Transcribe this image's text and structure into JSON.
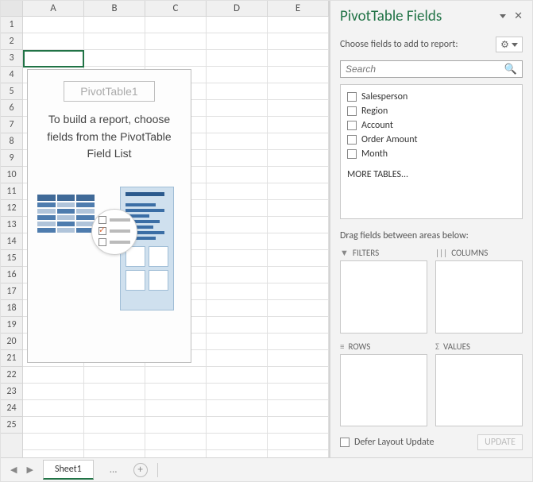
{
  "columns": [
    "A",
    "B",
    "C",
    "D",
    "E"
  ],
  "rows": [
    "1",
    "2",
    "3",
    "4",
    "5",
    "6",
    "7",
    "8",
    "9",
    "10",
    "11",
    "12",
    "13",
    "14",
    "15",
    "16",
    "17",
    "18",
    "19",
    "20",
    "21",
    "22",
    "23",
    "24",
    "25"
  ],
  "pivot": {
    "title": "PivotTable1",
    "message": "To build a report, choose fields from the PivotTable Field List"
  },
  "sidebar": {
    "title": "PivotTable Fields",
    "choose_label": "Choose fields to add to report:",
    "search_placeholder": "Search",
    "fields": [
      "Salesperson",
      "Region",
      "Account",
      "Order Amount",
      "Month"
    ],
    "more_label": "MORE TABLES...",
    "drag_label": "Drag fields between areas below:",
    "areas": {
      "filters": "FILTERS",
      "columns": "COLUMNS",
      "rows": "ROWS",
      "values": "VALUES"
    },
    "defer_label": "Defer Layout Update",
    "update_label": "UPDATE"
  },
  "tabs": {
    "sheet1": "Sheet1"
  }
}
